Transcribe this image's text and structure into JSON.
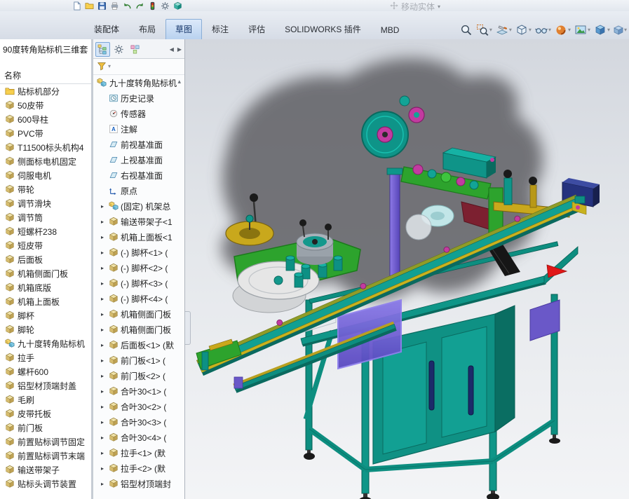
{
  "app": {
    "disabled_command": "移动实体"
  },
  "quick_access": {
    "icons": [
      "new-document",
      "open",
      "save",
      "print",
      "undo",
      "redo",
      "rebuild",
      "options",
      "part-teal"
    ]
  },
  "ribbon": {
    "tabs": [
      {
        "label": "装配体",
        "active": false
      },
      {
        "label": "布局",
        "active": false
      },
      {
        "label": "草图",
        "active": true
      },
      {
        "label": "标注",
        "active": false
      },
      {
        "label": "评估",
        "active": false
      },
      {
        "label": "SOLIDWORKS 插件",
        "active": false
      },
      {
        "label": "MBD",
        "active": false
      }
    ],
    "view_tools": [
      {
        "name": "zoom-fit",
        "caret": false
      },
      {
        "name": "zoom-area",
        "caret": true
      },
      {
        "name": "section-view",
        "caret": true
      },
      {
        "name": "display-style",
        "caret": true
      },
      {
        "name": "hide-show",
        "caret": true
      },
      {
        "name": "edit-appearance",
        "caret": true
      },
      {
        "name": "apply-scene",
        "caret": true
      },
      {
        "name": "view-orientation",
        "caret": true
      }
    ]
  },
  "left_panel": {
    "title": "90度转角贴标机三维套",
    "name_header": "名称",
    "items": [
      {
        "label": "贴标机部分",
        "icon": "folder"
      },
      {
        "label": "50皮带",
        "icon": "part"
      },
      {
        "label": "600导柱",
        "icon": "part"
      },
      {
        "label": "PVC带",
        "icon": "part"
      },
      {
        "label": "T11500标头机构4",
        "icon": "part"
      },
      {
        "label": "侧面标电机固定",
        "icon": "part"
      },
      {
        "label": "伺服电机",
        "icon": "part"
      },
      {
        "label": "带轮",
        "icon": "part"
      },
      {
        "label": "调节滑块",
        "icon": "part"
      },
      {
        "label": "调节筒",
        "icon": "part"
      },
      {
        "label": "短螺杆238",
        "icon": "part"
      },
      {
        "label": "短皮带",
        "icon": "part"
      },
      {
        "label": "后面板",
        "icon": "part"
      },
      {
        "label": "机箱侧面门板",
        "icon": "part"
      },
      {
        "label": "机箱底版",
        "icon": "part"
      },
      {
        "label": "机箱上面板",
        "icon": "part"
      },
      {
        "label": "脚杯",
        "icon": "part"
      },
      {
        "label": "脚轮",
        "icon": "part"
      },
      {
        "label": "九十度转角贴标机",
        "icon": "assembly"
      },
      {
        "label": "拉手",
        "icon": "part"
      },
      {
        "label": "螺杆600",
        "icon": "part"
      },
      {
        "label": "铝型材顶端封盖",
        "icon": "part"
      },
      {
        "label": "毛刷",
        "icon": "part"
      },
      {
        "label": "皮带托板",
        "icon": "part"
      },
      {
        "label": "前门板",
        "icon": "part"
      },
      {
        "label": "前置贴标调节固定",
        "icon": "part"
      },
      {
        "label": "前置贴标调节末端",
        "icon": "part"
      },
      {
        "label": "输送带架子",
        "icon": "part"
      },
      {
        "label": "贴标头调节装置",
        "icon": "part"
      }
    ]
  },
  "feature_tree": {
    "tabs": [
      "feature-manager",
      "property-manager",
      "configuration-manager"
    ],
    "root": {
      "label": "九十度转角贴标机",
      "icon": "assembly"
    },
    "items": [
      {
        "label": "历史记录",
        "icon": "history",
        "expand": false
      },
      {
        "label": "传感器",
        "icon": "sensor",
        "expand": false
      },
      {
        "label": "注解",
        "icon": "annotation",
        "expand": false
      },
      {
        "label": "前视基准面",
        "icon": "plane",
        "expand": false
      },
      {
        "label": "上视基准面",
        "icon": "plane",
        "expand": false
      },
      {
        "label": "右视基准面",
        "icon": "plane",
        "expand": false
      },
      {
        "label": "原点",
        "icon": "origin",
        "expand": false
      },
      {
        "label": "(固定) 机架总",
        "icon": "assembly",
        "expand": true
      },
      {
        "label": "输送带架子<1",
        "icon": "part",
        "expand": true
      },
      {
        "label": "机箱上面板<1",
        "icon": "part",
        "expand": true
      },
      {
        "label": "(-) 脚杯<1> (",
        "icon": "part",
        "expand": true
      },
      {
        "label": "(-) 脚杯<2> (",
        "icon": "part",
        "expand": true
      },
      {
        "label": "(-) 脚杯<3> (",
        "icon": "part",
        "expand": true
      },
      {
        "label": "(-) 脚杯<4> (",
        "icon": "part",
        "expand": true
      },
      {
        "label": "机箱侧面门板",
        "icon": "part",
        "expand": true
      },
      {
        "label": "机箱侧面门板",
        "icon": "part",
        "expand": true
      },
      {
        "label": "后面板<1> (默",
        "icon": "part",
        "expand": true
      },
      {
        "label": "前门板<1> (",
        "icon": "part",
        "expand": true
      },
      {
        "label": "前门板<2> (",
        "icon": "part",
        "expand": true
      },
      {
        "label": "合叶30<1> (",
        "icon": "part",
        "expand": true
      },
      {
        "label": "合叶30<2> (",
        "icon": "part",
        "expand": true
      },
      {
        "label": "合叶30<3> (",
        "icon": "part",
        "expand": true
      },
      {
        "label": "合叶30<4> (",
        "icon": "part",
        "expand": true
      },
      {
        "label": "拉手<1> (默",
        "icon": "part",
        "expand": true
      },
      {
        "label": "拉手<2> (默",
        "icon": "part",
        "expand": true
      },
      {
        "label": "铝型材顶端封",
        "icon": "part",
        "expand": true
      }
    ]
  },
  "colors": {
    "accent_blue": "#2b6fc0",
    "selection_blue": "#cfe2f7",
    "model_teal": "#0e9488",
    "model_green": "#2da32d",
    "model_magenta": "#c23ba0",
    "model_purple": "#6a58c8",
    "model_gold": "#c9a81c"
  }
}
